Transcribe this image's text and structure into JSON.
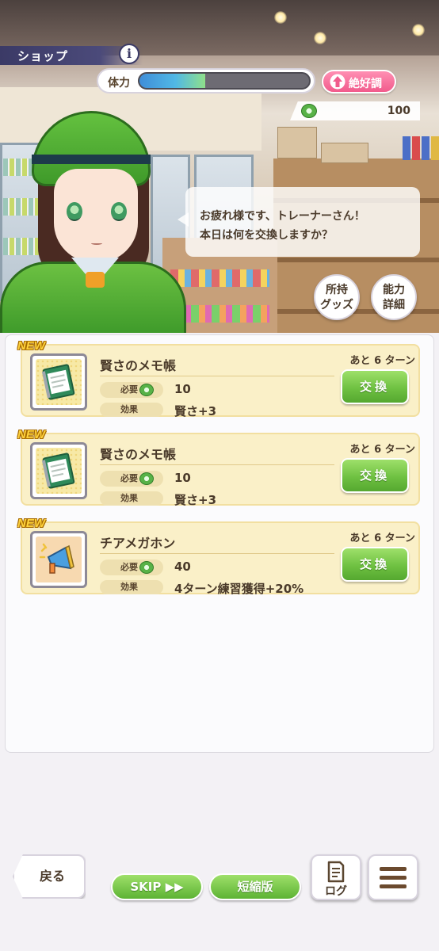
{
  "header": {
    "title": "ショップ",
    "info_label": "i",
    "stamina_label": "体力",
    "stamina_fraction": 0.39,
    "mood_label": "絶好調",
    "coins": "100"
  },
  "dialogue": {
    "line1": "お疲れ様です、トレーナーさん！",
    "line2": "本日は何を交換しますか？"
  },
  "side_buttons": {
    "goods_line1": "所持",
    "goods_line2": "グッズ",
    "stats_line1": "能力",
    "stats_line2": "詳細"
  },
  "items": [
    {
      "new_label": "NEW",
      "name": "賢さのメモ帳",
      "required_label": "必要",
      "cost": "10",
      "effect_label": "効果",
      "effect": "賢さ+3",
      "turns_left": "あと 6 ターン",
      "button_label": "交換",
      "icon": "memo-notebook-icon"
    },
    {
      "new_label": "NEW",
      "name": "賢さのメモ帳",
      "required_label": "必要",
      "cost": "10",
      "effect_label": "効果",
      "effect": "賢さ+3",
      "turns_left": "あと 6 ターン",
      "button_label": "交換",
      "icon": "memo-notebook-icon"
    },
    {
      "new_label": "NEW",
      "name": "チアメガホン",
      "required_label": "必要",
      "cost": "40",
      "effect_label": "効果",
      "effect": "4ターン練習獲得+20%",
      "turns_left": "あと 6 ターン",
      "button_label": "交換",
      "icon": "megaphone-icon"
    }
  ],
  "footer": {
    "back_label": "戻る",
    "skip_label": "SKIP ▶▶",
    "short_label": "短縮版",
    "log_label": "ログ",
    "menu_icon": "hamburger-menu-icon"
  },
  "colors": {
    "accent_green": "#6fc142",
    "mood_pink": "#f15b8c",
    "card_bg": "#faf0c8"
  }
}
